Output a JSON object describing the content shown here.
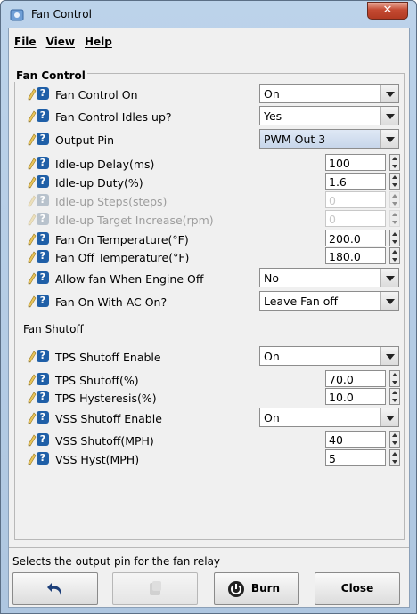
{
  "window": {
    "title": "Fan Control",
    "close_glyph": "✕"
  },
  "menu": [
    {
      "label": "File"
    },
    {
      "label": "View"
    },
    {
      "label": "Help"
    }
  ],
  "panel": {
    "title": "Fan Control"
  },
  "rows": [
    {
      "label": "Fan Control On",
      "kind": "combo",
      "value": "On"
    },
    {
      "label": "Fan Control Idles up?",
      "kind": "combo",
      "value": "Yes"
    },
    {
      "label": "Output Pin",
      "kind": "combo",
      "value": "PWM Out 3",
      "selected": true
    },
    {
      "label": "Idle-up Delay(ms)",
      "kind": "spin",
      "value": "100"
    },
    {
      "label": "Idle-up Duty(%)",
      "kind": "spin",
      "value": "1.6"
    },
    {
      "label": "Idle-up Steps(steps)",
      "kind": "spin",
      "value": "0",
      "disabled": true
    },
    {
      "label": "Idle-up Target Increase(rpm)",
      "kind": "spin",
      "value": "0",
      "disabled": true
    },
    {
      "label": "Fan On Temperature(°F)",
      "kind": "spin",
      "value": "200.0"
    },
    {
      "label": "Fan Off Temperature(°F)",
      "kind": "spin",
      "value": "180.0"
    },
    {
      "label": "Allow fan When Engine Off",
      "kind": "combo",
      "value": "No"
    },
    {
      "label": "Fan On With AC On?",
      "kind": "combo",
      "value": "Leave Fan off"
    }
  ],
  "section2": {
    "title": "Fan Shutoff"
  },
  "rows2": [
    {
      "label": "TPS Shutoff Enable",
      "kind": "combo",
      "value": "On"
    },
    {
      "label": "TPS Shutoff(%)",
      "kind": "spin",
      "value": "70.0"
    },
    {
      "label": "TPS Hysteresis(%)",
      "kind": "spin",
      "value": "10.0"
    },
    {
      "label": "VSS Shutoff Enable",
      "kind": "combo",
      "value": "On"
    },
    {
      "label": "VSS Shutoff(MPH)",
      "kind": "spin",
      "value": "40"
    },
    {
      "label": "VSS Hyst(MPH)",
      "kind": "spin",
      "value": "5"
    }
  ],
  "status": {
    "text": "Selects the output pin for the fan relay"
  },
  "buttons": {
    "burn_label": "Burn",
    "close_label": "Close",
    "undo_icon": "undo-icon",
    "redo_icon": "redo-icon",
    "burn_icon": "power-icon"
  },
  "icons": {
    "help": "?",
    "pencil": "pencil-icon"
  },
  "colors": {
    "help_badge": "#1f5fa7",
    "title_bar": "#bcd3ea",
    "close_button": "#c44a32"
  }
}
